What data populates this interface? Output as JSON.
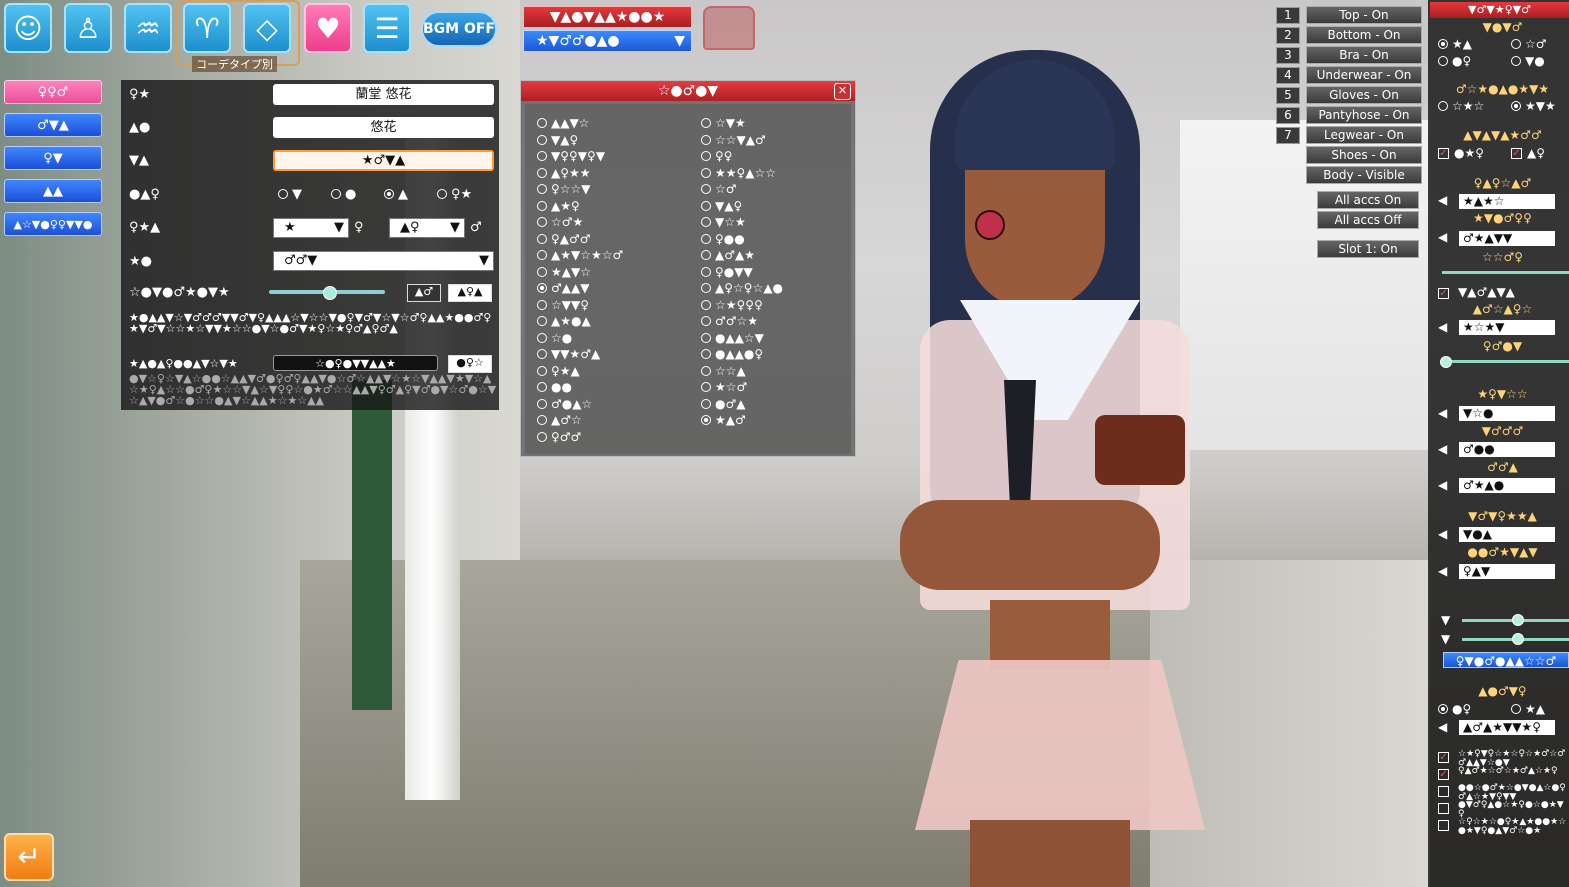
{
  "topbar": {
    "icons": [
      "face-icon",
      "body-icon",
      "hair-icon",
      "clothes-icon",
      "accessory-icon",
      "heart-icon",
      "document-icon"
    ],
    "coord_label": "コーデタイプ別",
    "bgm_label": "BGM OFF"
  },
  "leftnav": {
    "items": [
      "♀♀♂",
      "♂▼▲",
      "♀▼",
      "▲▲",
      "▲☆▼●♀♀▼▼●"
    ]
  },
  "profile": {
    "name_label": "♀★",
    "name_value": "蘭堂 悠花",
    "nick_label": "▲●",
    "nick_value": "悠花",
    "third_label": "▼▲",
    "third_value": "★♂▼▲",
    "radio_label": "●▲♀",
    "radio_options": [
      "▼",
      "●",
      "▲",
      "♀★"
    ],
    "birth_label": "♀★▲",
    "birth_month": "★",
    "birth_month_suffix": "♀",
    "birth_day": "▲♀",
    "birth_day_suffix": "♂",
    "type_label": "★●",
    "type_value": "♂♂▼",
    "slider_label": "☆●▼●♂★●▼★",
    "slider_value": 0.52,
    "btn1": "▲♂",
    "btn2": "▲♀▲",
    "desc": "★●▲▲▼☆▼♂♂♂▼▼♂▼♀▲▲▲☆▼☆☆▼●♀▼♂▼☆▼☆♂♀▲▲★●●♂♀★▼♂▼☆☆★☆▼▼★☆☆●▼☆●♂▼★♀☆★♀♂▲♀♂▲",
    "sub_label": "★▲●▲♀●●▲▼☆▼★",
    "sub_value": "☆●♀●▼▼▲▲★",
    "sub_btn": "●♀☆",
    "footer": "●▼☆♀☆▼▲☆●●☆▲▲▼♂●♀♂♀▲▲▼●☆♂☆▲▲▼☆★☆▼▲▲▼★▼☆▲☆★♀▲☆☆●♂♀★☆☆▼▲☆▼♀♀☆●★♂☆☆▲▲▼♀♂▲♀▼♂●▼☆♂●☆▼☆▲▼●♂☆●☆☆●▲▼☆▲▲★☆★☆▲▲"
  },
  "redbar": "▼▲●▼▲▲★●●★",
  "bluebar": "★▼♂♂●▲●",
  "listwin": {
    "title": "☆●♂●▼",
    "close": "✕",
    "left": [
      "▲▲▼☆",
      "▼▲♀",
      "▼♀♀▼♀▼",
      "▲♀★★",
      "♀☆☆▼",
      "▲★♀",
      "☆♂★",
      "♀▲♂♂",
      "▲★▼☆★☆♂",
      "★▲▼☆",
      "♂▲▲▼",
      "☆▼▼♀",
      "▲★●▲",
      "☆●",
      "▼▼★♂▲",
      "♀★▲",
      "●●",
      "♂●▲☆",
      "▲♂☆",
      "♀♂♂"
    ],
    "right": [
      "☆▼★",
      "☆☆▼▲♂",
      "♀♀",
      "★★♀▲☆☆",
      "☆♂",
      "▼▲♀",
      "▼☆★",
      "♀●●",
      "▲♂▲★",
      "♀●▼▼",
      "▲♀☆♀☆▲●",
      "☆★♀♀♀",
      "♂♂☆★",
      "●▲▲☆▼",
      "●▲▲●♀",
      "☆☆▲",
      "★☆♂",
      "●♂▲",
      "★▲♂"
    ],
    "left_selected": 10,
    "right_selected": 18
  },
  "toggles": [
    "Top - On",
    "Bottom - On",
    "Bra - On",
    "Underwear - On",
    "Gloves - On",
    "Pantyhose - On",
    "Legwear - On",
    "Shoes - On",
    "Body - Visible"
  ],
  "slot_numbers": [
    "1",
    "2",
    "3",
    "4",
    "5",
    "6",
    "7"
  ],
  "accs_on": "All accs On",
  "accs_off": "All accs Off",
  "slot_label": "Slot 1: On",
  "rpanel": {
    "title": "▼♂▼★♀▼♂",
    "h1": "▼●▼♂",
    "r1a": "★▲",
    "r1b": "☆♂",
    "r2a": "●♀",
    "r2b": "▼●",
    "h2": "♂☆★●▲●★▼★",
    "r3a": "☆★☆",
    "r3b": "★▼★",
    "h3": "▲▼▲▼▲★♂♂",
    "c1": "●★♀",
    "c2": "▲♀",
    "h4": "♀▲♀☆▲♂",
    "b1": "★▲★☆",
    "h5": "★▼●♂♀♀",
    "b2": "♂★▲▼▼",
    "h6": "☆☆♂♀",
    "c3": "▼▲♂▲▼▲",
    "h7": "▲♂☆▲♀☆",
    "b3": "★☆★▼",
    "h8": "♀♂●▼",
    "h9": "★♀▼☆☆",
    "b4": "▼☆●",
    "h10": "▼♂♂♂",
    "b5": "♂●●",
    "h11": "♂♂▲",
    "b6": "♂★▲●",
    "h12": "▼♂▼♀★★▲",
    "b7": "▼●▲",
    "h13": "●●♂★▼▲▼",
    "b8": "♀▲▼",
    "blue_btn": "♀▼●♂●▲▲☆☆♂",
    "h14": "▲●♂▼♀",
    "r4a": "●♀",
    "r4b": "★▲",
    "b9": "▲♂▲★▼▼★♀",
    "checks": [
      "☆★♀▼♀☆★☆♀☆★♂☆♂♂▲▲▼☆●▼",
      "♀▲♂★☆♂☆★♂▲☆★♀",
      "●●☆●♂★☆●▼●▲☆●♀♂▲☆★▼♀▼▼",
      "●▼♂♀▲●☆★♀●☆●★▼♀",
      "☆♀☆★☆●♀★▲★●●★☆●★▼♀●▲▼♂☆●★"
    ]
  },
  "back_icon": "return-icon"
}
